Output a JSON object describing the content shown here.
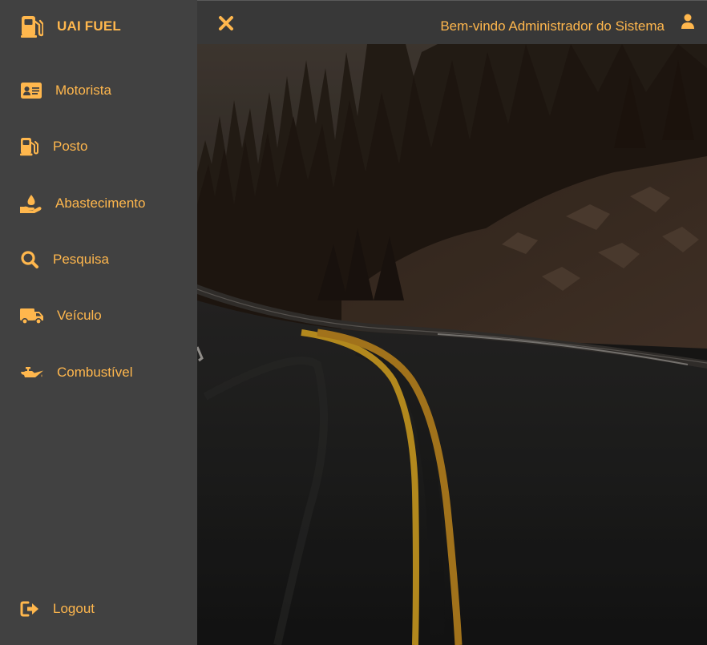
{
  "app": {
    "brand": "UAI FUEL"
  },
  "sidebar": {
    "items": [
      {
        "label": "Motorista",
        "icon": "id-card-icon"
      },
      {
        "label": "Posto",
        "icon": "gas-pump-icon"
      },
      {
        "label": "Abastecimento",
        "icon": "hand-holding-drop-icon"
      },
      {
        "label": "Pesquisa",
        "icon": "search-icon"
      },
      {
        "label": "Veículo",
        "icon": "truck-icon"
      },
      {
        "label": "Combustível",
        "icon": "oil-can-icon"
      }
    ],
    "logout": {
      "label": "Logout",
      "icon": "sign-out-icon"
    }
  },
  "header": {
    "welcome": "Bem-vindo Administrador do Sistema",
    "close_icon": "close-icon",
    "user_icon": "user-icon"
  },
  "hero": {
    "image": "dark forest road with double yellow center line"
  },
  "colors": {
    "accent": "#ffb74d",
    "sidebar_bg": "#414141",
    "topbar_bg": "#383838"
  }
}
